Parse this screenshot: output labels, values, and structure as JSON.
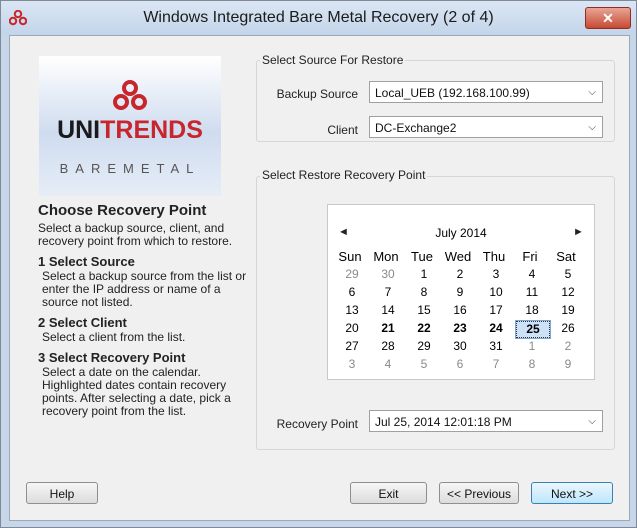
{
  "window": {
    "title": "Windows Integrated Bare Metal Recovery (2 of 4)",
    "close_glyph": "✕"
  },
  "logo": {
    "brand_left": "UNI",
    "brand_mid": "TRENDS",
    "sub": "BAREMETAL"
  },
  "help": {
    "heading": "Choose Recovery Point",
    "intro": "Select a backup source, client, and recovery point from which to restore.",
    "steps": [
      {
        "title": "1 Select Source",
        "text": "Select a backup source from the list or enter the IP address or name of a source not listed."
      },
      {
        "title": "2 Select Client",
        "text": "Select a client from the list."
      },
      {
        "title": "3 Select Recovery Point",
        "text": "Select a date on the calendar. Highlighted dates contain recovery points.  After selecting a date, pick a recovery point from the list."
      }
    ]
  },
  "source_group": {
    "label": "Select Source For Restore",
    "backup_source_label": "Backup Source",
    "backup_source_value": "Local_UEB (192.168.100.99)",
    "client_label": "Client",
    "client_value": "DC-Exchange2"
  },
  "restore_group": {
    "label": "Select Restore Recovery Point",
    "recovery_point_label": "Recovery Point",
    "recovery_point_value": "Jul 25, 2014   12:01:18 PM"
  },
  "calendar": {
    "month_title": "July 2014",
    "prev_glyph": "◄",
    "next_glyph": "►",
    "weekdays": [
      "Sun",
      "Mon",
      "Tue",
      "Wed",
      "Thu",
      "Fri",
      "Sat"
    ],
    "weeks": [
      [
        {
          "d": "29",
          "o": true
        },
        {
          "d": "30",
          "o": true
        },
        {
          "d": "1"
        },
        {
          "d": "2"
        },
        {
          "d": "3"
        },
        {
          "d": "4"
        },
        {
          "d": "5"
        }
      ],
      [
        {
          "d": "6"
        },
        {
          "d": "7"
        },
        {
          "d": "8"
        },
        {
          "d": "9"
        },
        {
          "d": "10"
        },
        {
          "d": "11"
        },
        {
          "d": "12"
        }
      ],
      [
        {
          "d": "13"
        },
        {
          "d": "14"
        },
        {
          "d": "15"
        },
        {
          "d": "16"
        },
        {
          "d": "17"
        },
        {
          "d": "18"
        },
        {
          "d": "19"
        }
      ],
      [
        {
          "d": "20"
        },
        {
          "d": "21",
          "b": true
        },
        {
          "d": "22",
          "b": true
        },
        {
          "d": "23",
          "b": true
        },
        {
          "d": "24",
          "b": true
        },
        {
          "d": "25",
          "b": true,
          "sel": true
        },
        {
          "d": "26"
        }
      ],
      [
        {
          "d": "27"
        },
        {
          "d": "28"
        },
        {
          "d": "29"
        },
        {
          "d": "30"
        },
        {
          "d": "31"
        },
        {
          "d": "1",
          "o": true
        },
        {
          "d": "2",
          "o": true
        }
      ],
      [
        {
          "d": "3",
          "o": true
        },
        {
          "d": "4",
          "o": true
        },
        {
          "d": "5",
          "o": true
        },
        {
          "d": "6",
          "o": true
        },
        {
          "d": "7",
          "o": true
        },
        {
          "d": "8",
          "o": true
        },
        {
          "d": "9",
          "o": true
        }
      ]
    ]
  },
  "buttons": {
    "help": "Help",
    "exit": "Exit",
    "previous": "<< Previous",
    "next": "Next >>"
  },
  "colors": {
    "accent": "#c7262c",
    "title_bg": "#c7d6e8"
  }
}
